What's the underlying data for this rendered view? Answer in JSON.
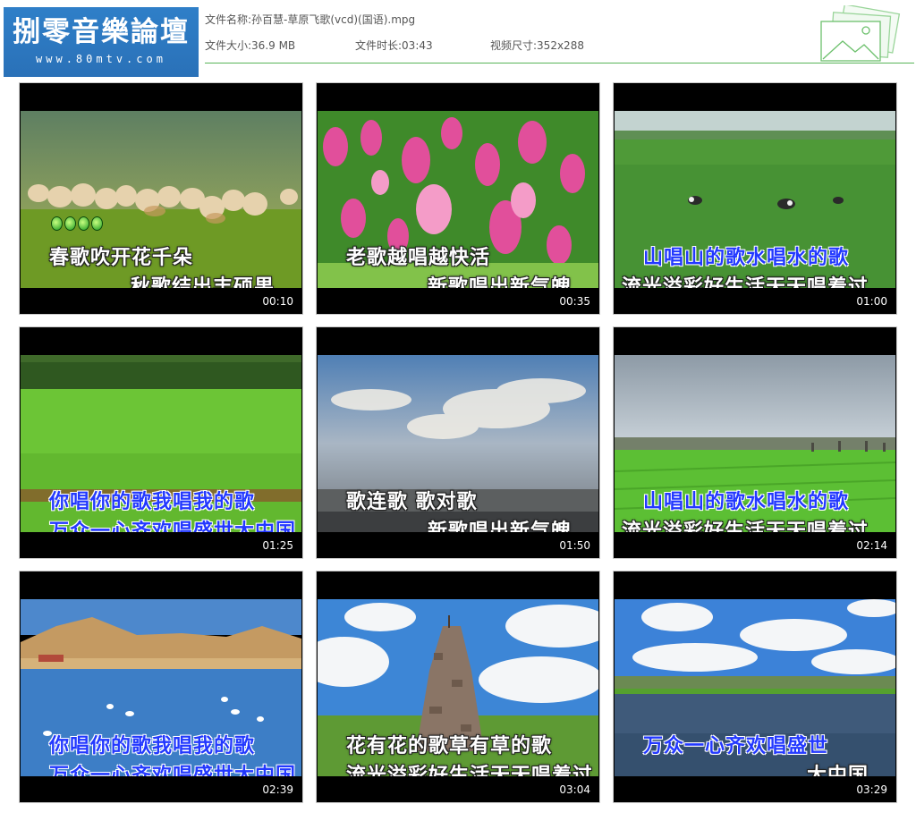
{
  "logo": {
    "chinese": "捌零音樂論壇",
    "url": "www.80mtv.com"
  },
  "file_info": {
    "name_label": "文件名称:",
    "name_value": "孙百慧-草原飞歌(vcd)(国语).mpg",
    "size_label": "文件大小:",
    "size_value": "36.9 MB",
    "duration_label": "文件时长:",
    "duration_value": "03:43",
    "dimensions_label": "视频尺寸:",
    "dimensions_value": "352x288"
  },
  "colors": {
    "accent_line": "#58b458",
    "logo_bg": "#2f7fc8",
    "karaoke_highlight": "#2238ff"
  },
  "icons": {
    "header_decoration": "photo-stack-icon"
  },
  "thumbnails": [
    {
      "scene": "sheep herd on grassland",
      "line1": "春歌吹开花千朵",
      "line2": "秋歌结出丰硕果",
      "time": "00:10"
    },
    {
      "scene": "pink wildflowers",
      "line1": "老歌越唱越快活",
      "line2": "新歌唱出新气魄",
      "time": "00:35"
    },
    {
      "scene": "cattle on green plain",
      "line1": "山唱山的歌水唱水的歌",
      "line2": "流光溢彩好生活天天唱着过",
      "time": "01:00"
    },
    {
      "scene": "meadow with tree line",
      "line1": "你唱你的歌我唱我的歌",
      "line2": "万众一心齐欢唱盛世大中国",
      "time": "01:25"
    },
    {
      "scene": "sunlit clouds over water",
      "line1": "歌连歌 歌对歌",
      "line2": "新歌唱出新气魄",
      "time": "01:50"
    },
    {
      "scene": "crop fields under cloudy sky",
      "line1": "山唱山的歌水唱水的歌",
      "line2": "流光溢彩好生活天天唱着过",
      "time": "02:14"
    },
    {
      "scene": "swans on lake below hills",
      "line1": "你唱你的歌我唱我的歌",
      "line2": "万众一心齐欢唱盛世大中国",
      "time": "02:39"
    },
    {
      "scene": "stone cairn (ovoo) under blue sky",
      "line1": "花有花的歌草有草的歌",
      "line2": "流光溢彩好生活天天唱着过",
      "time": "03:04"
    },
    {
      "scene": "lake with cumulus clouds",
      "line1": "万众一心齐欢唱盛世",
      "line2": "大中国",
      "time": "03:29"
    }
  ]
}
